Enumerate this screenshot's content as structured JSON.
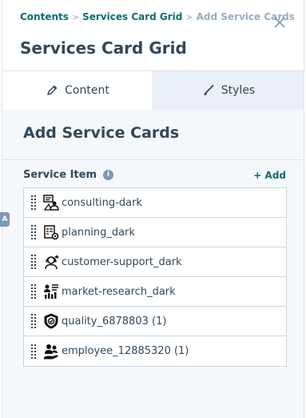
{
  "breadcrumb": {
    "items": [
      "Contents",
      "Services Card Grid",
      "Add Service Cards"
    ],
    "separator": ">"
  },
  "close_icon": "close-icon",
  "page_title": "Services Card Grid",
  "side_tab_label": "A",
  "tabs": [
    {
      "label": "Content",
      "icon": "pencil-icon",
      "active": true
    },
    {
      "label": "Styles",
      "icon": "brush-icon",
      "active": false
    }
  ],
  "section_title": "Add Service Cards",
  "field": {
    "label": "Service Item",
    "info_icon": "info-icon",
    "add_label": "+ Add"
  },
  "items": [
    {
      "label": "consulting-dark",
      "icon": "consulting-icon"
    },
    {
      "label": "planning_dark",
      "icon": "planning-icon"
    },
    {
      "label": "customer-support_dark",
      "icon": "customer-support-icon"
    },
    {
      "label": "market-research_dark",
      "icon": "market-research-icon"
    },
    {
      "label": "quality_6878803 (1)",
      "icon": "quality-badge-icon"
    },
    {
      "label": "employee_12885320 (1)",
      "icon": "employee-icon"
    }
  ],
  "colors": {
    "accent": "#0b6e6e",
    "text": "#33475b",
    "muted": "#99acc2",
    "border": "#cbd6e2",
    "panel_bg": "#f5f8fa"
  }
}
